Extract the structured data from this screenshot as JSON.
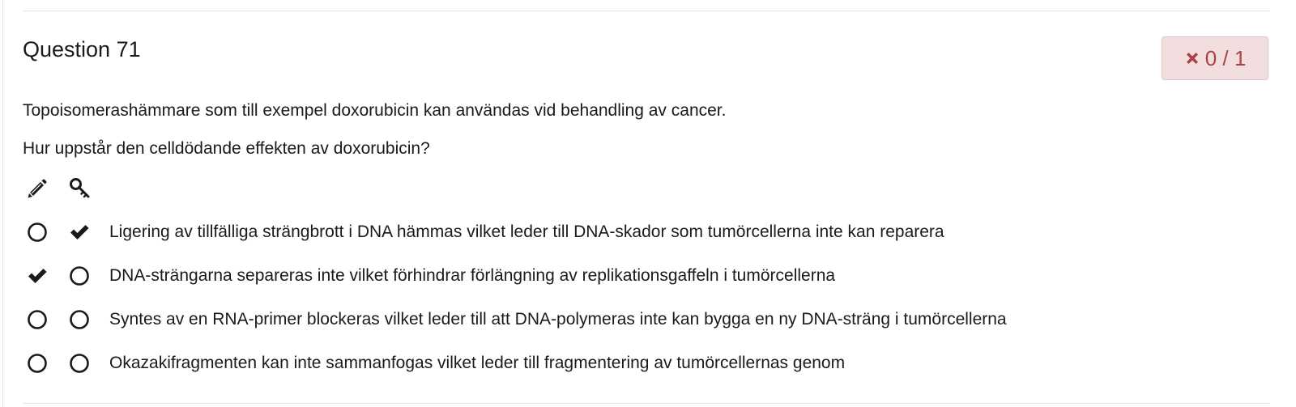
{
  "question": {
    "title": "Question 71",
    "score": "0 / 1",
    "score_icon": "times-icon",
    "prompt_lines": [
      "Topoisomerashämmare som till exempel doxorubicin kan användas vid behandling av cancer.",
      "Hur uppstår den celldödande effekten av doxorubicin?"
    ]
  },
  "legend": {
    "student_column_icon": "pencil-icon",
    "key_column_icon": "key-icon"
  },
  "options": [
    {
      "text": "Ligering av tillfälliga strängbrott i DNA hämmas vilket leder till DNA-skador som tumörcellerna inte kan reparera",
      "student_selected": false,
      "correct": true
    },
    {
      "text": "DNA-strängarna separeras inte vilket förhindrar förlängning av replikationsgaffeln i tumörcellerna",
      "student_selected": true,
      "correct": false
    },
    {
      "text": "Syntes av en RNA-primer blockeras vilket leder till att DNA-polymeras inte kan bygga en ny DNA-sträng i tumörcellerna",
      "student_selected": false,
      "correct": false
    },
    {
      "text": "Okazakifragmenten kan inte sammanfogas vilket leder till fragmentering av tumörcellernas genom",
      "student_selected": false,
      "correct": false
    }
  ],
  "colors": {
    "badge_background": "#f2dede",
    "badge_border": "#ebc4c4",
    "badge_text": "#a94442",
    "text": "#1a1a1a"
  }
}
